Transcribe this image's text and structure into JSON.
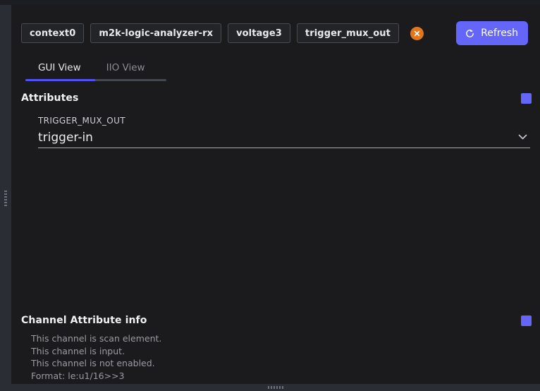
{
  "breadcrumb": {
    "items": [
      {
        "label": "context0"
      },
      {
        "label": "m2k-logic-analyzer-rx"
      },
      {
        "label": "voltage3"
      },
      {
        "label": "trigger_mux_out"
      }
    ],
    "close_icon": "close-circle-icon"
  },
  "toolbar": {
    "refresh_label": "Refresh",
    "refresh_icon": "refresh-icon",
    "accent_color": "#6366f8"
  },
  "tabs": {
    "items": [
      {
        "label": "GUI View",
        "active": true
      },
      {
        "label": "IIO View",
        "active": false
      }
    ],
    "active_color": "#4e52f2",
    "inactive_color": "#46484f"
  },
  "attributes": {
    "title": "Attributes",
    "collapse_icon": "collapse-toggle",
    "fields": [
      {
        "label": "TRIGGER_MUX_OUT",
        "value": "trigger-in",
        "chevron_icon": "chevron-down-icon"
      }
    ]
  },
  "channel_info": {
    "title": "Channel Attribute info",
    "collapse_icon": "collapse-toggle",
    "lines": [
      "This channel is scan element.",
      "This channel is input.",
      "This channel is not enabled.",
      "Format: le:u1/16>>3"
    ]
  },
  "splitters": {
    "left_handle_icon": "vertical-drag-handle",
    "bottom_handle_icon": "horizontal-drag-handle"
  }
}
